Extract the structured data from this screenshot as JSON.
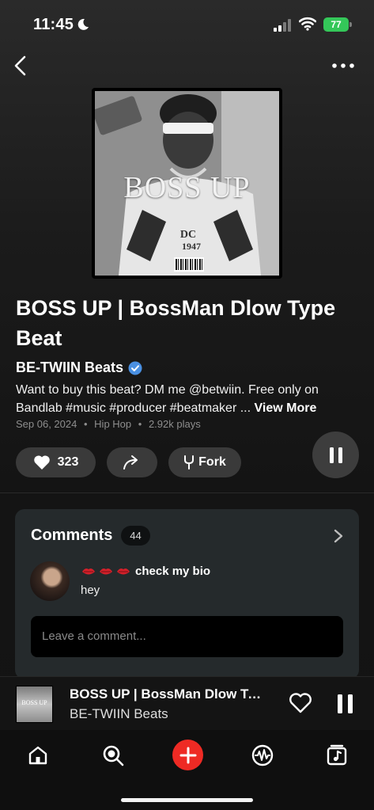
{
  "status_bar": {
    "time": "11:45",
    "battery": "77"
  },
  "track": {
    "cover_text": "BOSS UP",
    "title": "BOSS UP | BossMan Dlow Type Beat",
    "artist": "BE-TWIIN Beats",
    "description": "Want to buy this beat? DM me @betwiin. Free only on Bandlab #music #producer #beatmaker ...",
    "view_more": "View More",
    "date": "Sep 06, 2024",
    "genre": "Hip Hop",
    "plays": "2.92k plays",
    "meta_separator": "•"
  },
  "actions": {
    "likes": "323",
    "fork_label": "Fork"
  },
  "comments": {
    "title": "Comments",
    "count": "44",
    "items": [
      {
        "user": "check my bio",
        "body": "hey"
      }
    ],
    "input_placeholder": "Leave a comment..."
  },
  "mini_player": {
    "title": "BOSS UP | BossMan Dlow Type Beat",
    "artist": "BE-TWIIN Beats",
    "art_text": "BOSS UP"
  },
  "icons": {
    "back": "chevron-left-icon",
    "more": "more-horizontal-icon",
    "like": "heart-icon",
    "share": "share-icon",
    "fork": "fork-icon",
    "pause": "pause-icon",
    "comments_open": "chevron-right-icon",
    "tabs": [
      "home-icon",
      "search-icon",
      "plus-icon",
      "waveform-icon",
      "library-icon"
    ]
  },
  "colors": {
    "battery": "#34c759",
    "verified": "#4a90e2",
    "create_button": "#ee2a24"
  }
}
